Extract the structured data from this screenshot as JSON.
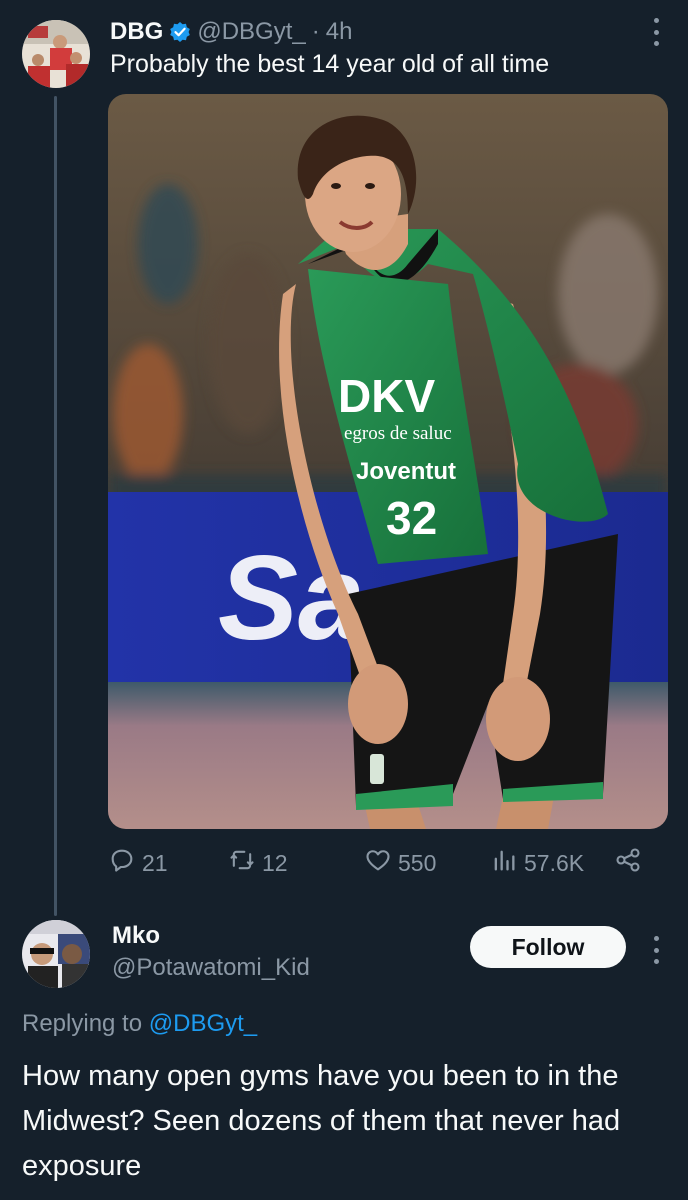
{
  "tweet": {
    "display_name": "DBG",
    "handle": "@DBGyt_",
    "separator": "·",
    "time": "4h",
    "text": "Probably the best 14 year old of all time",
    "media": {
      "jersey_sponsor": "DKV",
      "jersey_sponsor_sub": "egros de saluc",
      "jersey_team": "Joventut",
      "jersey_number": "32",
      "banner_text": "Sa"
    },
    "actions": {
      "replies": "21",
      "retweets": "12",
      "likes": "550",
      "views": "57.6K"
    }
  },
  "reply": {
    "display_name": "Mko",
    "handle": "@Potawatomi_Kid",
    "follow_label": "Follow",
    "replying_prefix": "Replying to ",
    "replying_mention": "@DBGyt_",
    "text": "How many open gyms have you been to in the Midwest? Seen dozens of them that never had exposure"
  },
  "colors": {
    "background": "#15202b",
    "text_primary": "#f7f9f9",
    "text_secondary": "#8b98a5",
    "accent": "#1d9bf0",
    "jersey_green": "#1f8a4a"
  },
  "icons": [
    "verified-badge-icon",
    "more-icon",
    "reply-icon",
    "retweet-icon",
    "like-icon",
    "views-icon",
    "share-icon"
  ]
}
